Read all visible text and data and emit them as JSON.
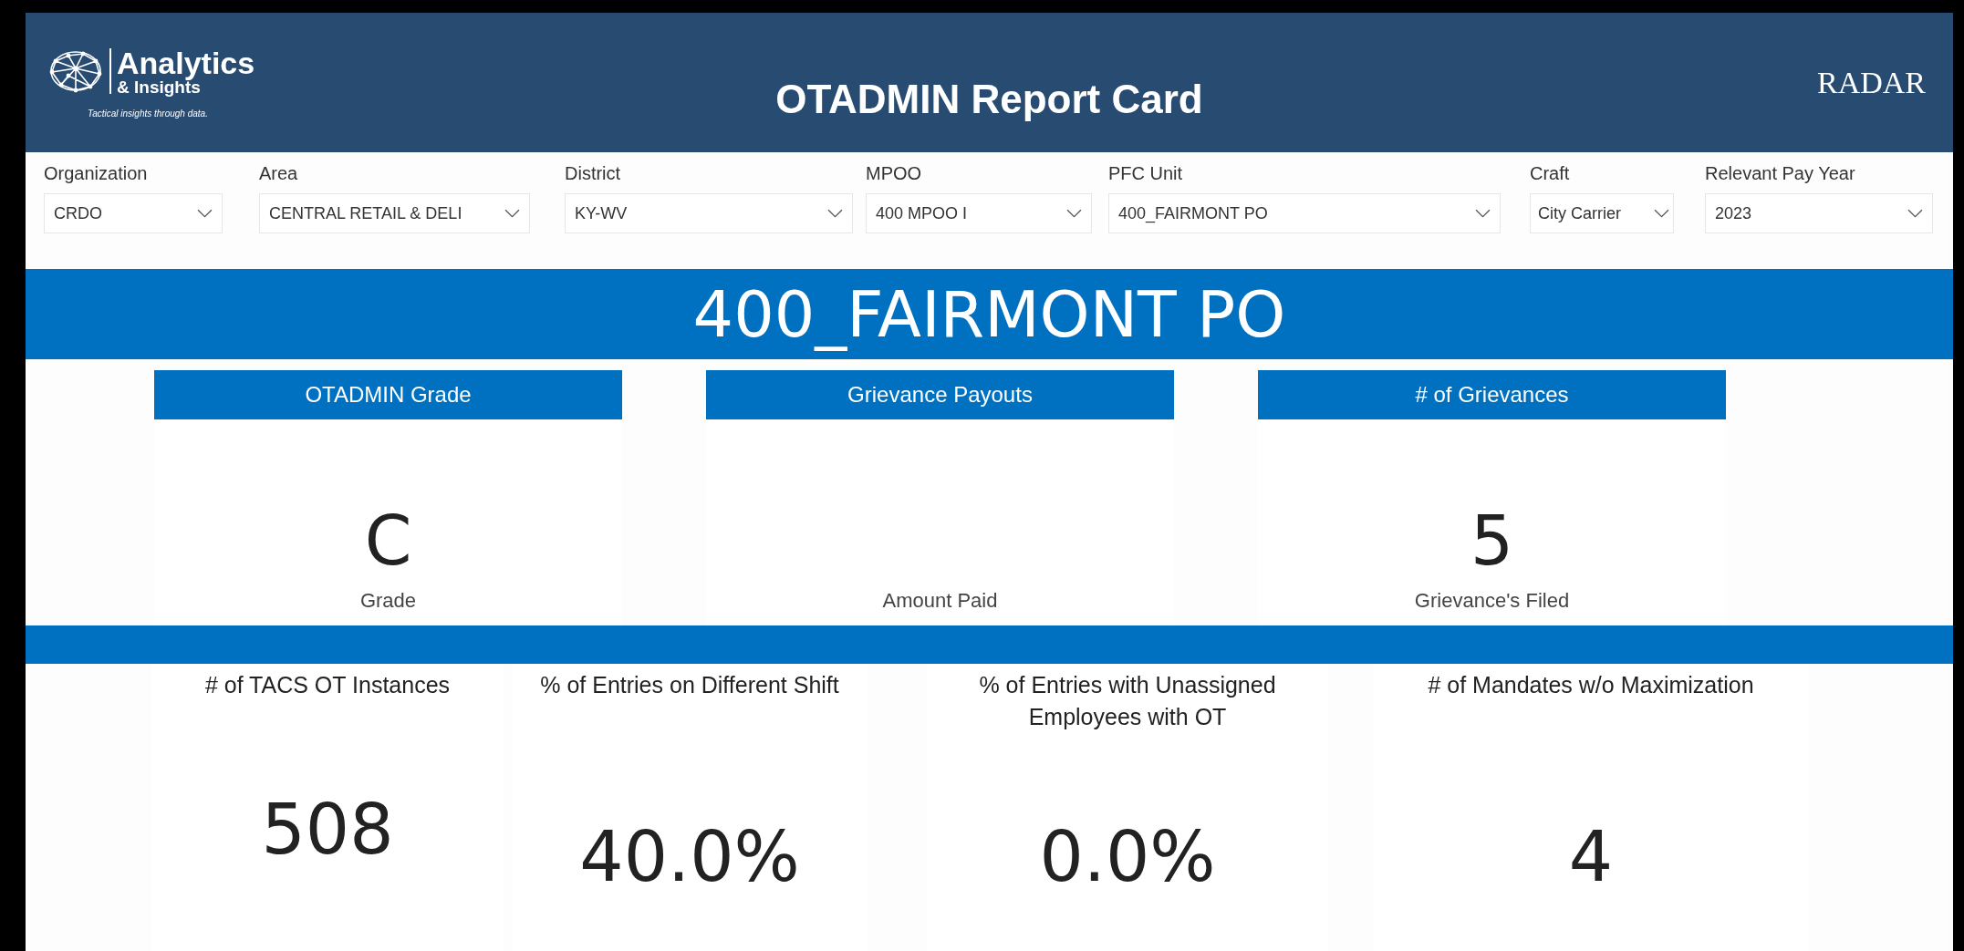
{
  "header": {
    "logo": {
      "title": "Analytics",
      "subtitle": "& Insights",
      "tagline": "Tactical insights through data."
    },
    "title": "OTADMIN Report Card",
    "brand": "RADAR"
  },
  "filters": [
    {
      "label": "Organization",
      "value": "CRDO"
    },
    {
      "label": "Area",
      "value": "CENTRAL RETAIL & DELI"
    },
    {
      "label": "District",
      "value": "KY-WV"
    },
    {
      "label": "MPOO",
      "value": "400 MPOO I"
    },
    {
      "label": "PFC Unit",
      "value": "400_FAIRMONT PO"
    },
    {
      "label": "Craft",
      "value": "City Carrier"
    },
    {
      "label": "Relevant Pay Year",
      "value": "2023"
    }
  ],
  "unit_banner": "400_FAIRMONT PO",
  "top_cards": [
    {
      "title": "OTADMIN Grade",
      "value": "C",
      "caption": "Grade"
    },
    {
      "title": "Grievance Payouts",
      "caption": "Amount Paid"
    },
    {
      "title": "# of Grievances",
      "value": "5",
      "caption": "Grievance's Filed"
    }
  ],
  "bottom_cards": [
    {
      "title": "# of TACS OT Instances",
      "value": "508"
    },
    {
      "title": "% of Entries on Different Shift",
      "value": "40.0%"
    },
    {
      "title": "% of Entries with Unassigned Employees with OT",
      "value": "0.0%"
    },
    {
      "title": "# of Mandates w/o Maximization",
      "value": "4"
    }
  ]
}
